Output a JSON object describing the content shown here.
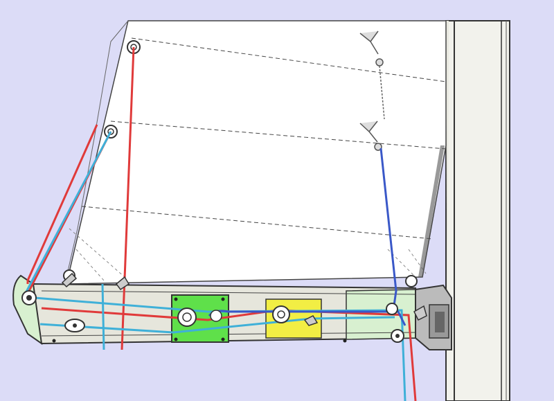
{
  "colors": {
    "background": "#dcdcf7",
    "sail": "#ffffff",
    "mast": "#f2f2ec",
    "boom": "#e6e6dc",
    "outline": "#333333",
    "red_line": "#e03a3a",
    "cyan_line": "#3fb0d8",
    "blue_line": "#3a58c8",
    "green_car": "#5fe04a",
    "yellow_car": "#f2ee44",
    "boom_end": "#d8f0d0"
  },
  "icons": {
    "reef_cringle": "eye-ring",
    "sheave": "pulley-wheel",
    "clutch": "cam-cleat",
    "snap_shackle": "wing-snap"
  }
}
